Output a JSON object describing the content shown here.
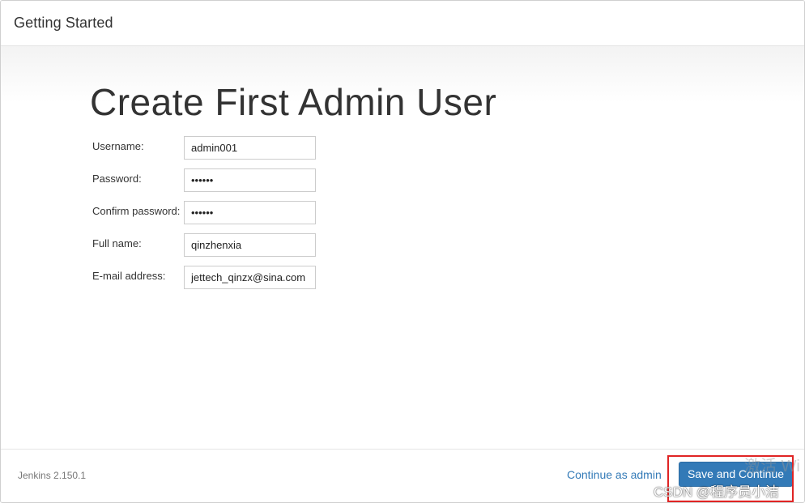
{
  "header": {
    "title": "Getting Started"
  },
  "main": {
    "heading": "Create First Admin User",
    "fields": [
      {
        "label": "Username:",
        "value": "admin001",
        "type": "text"
      },
      {
        "label": "Password:",
        "value": "••••••",
        "type": "password"
      },
      {
        "label": "Confirm password:",
        "value": "••••••",
        "type": "password"
      },
      {
        "label": "Full name:",
        "value": "qinzhenxia",
        "type": "text"
      },
      {
        "label": "E-mail address:",
        "value": "jettech_qinzx@sina.com",
        "type": "text"
      }
    ]
  },
  "footer": {
    "version": "Jenkins 2.150.1",
    "continue_link": "Continue as admin",
    "save_button": "Save and Continue"
  },
  "overlays": {
    "activate_watermark": "激活 Wi",
    "csdn_watermark": "CSDN @程序员小洁",
    "highlight_color": "#e02424"
  },
  "colors": {
    "accent": "#337ab7",
    "text": "#333333"
  }
}
